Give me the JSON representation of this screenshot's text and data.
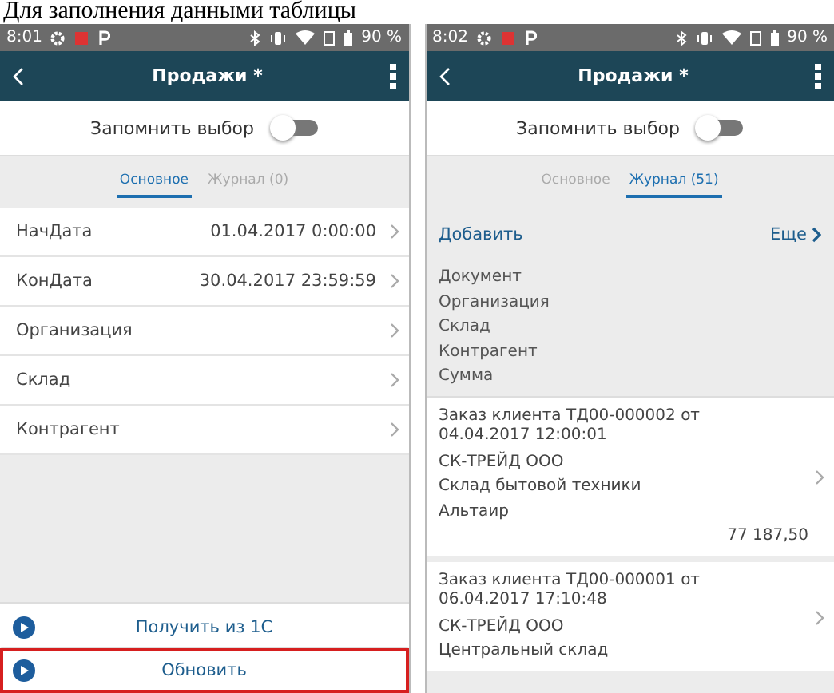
{
  "caption": "Для заполнения данными таблицы",
  "screens": [
    {
      "kind": "form",
      "status_bar": {
        "time": "8:01",
        "battery": "90 %"
      },
      "header": {
        "title": "Продажи *"
      },
      "remember": {
        "label": "Запомнить выбор",
        "on": false
      },
      "tabs": [
        {
          "label": "Основное",
          "selected": true
        },
        {
          "label": "Журнал (0)",
          "selected": false
        }
      ],
      "fields": [
        {
          "label": "НачДата",
          "value": "01.04.2017 0:00:00"
        },
        {
          "label": "КонДата",
          "value": "30.04.2017 23:59:59"
        },
        {
          "label": "Организация"
        },
        {
          "label": "Склад"
        },
        {
          "label": "Контрагент"
        }
      ],
      "buttons": [
        {
          "label": "Получить из 1С",
          "highlighted": false
        },
        {
          "label": "Обновить",
          "highlighted": true
        }
      ]
    },
    {
      "kind": "journal",
      "status_bar": {
        "time": "8:02",
        "battery": "90 %"
      },
      "header": {
        "title": "Продажи *"
      },
      "remember": {
        "label": "Запомнить выбор",
        "on": false
      },
      "tabs": [
        {
          "label": "Основное",
          "selected": false
        },
        {
          "label": "Журнал (51)",
          "selected": true
        }
      ],
      "actions": {
        "add": "Добавить",
        "more": "Еще"
      },
      "columns": [
        "Документ",
        "Организация",
        "Склад",
        "Контрагент",
        "Сумма"
      ],
      "entries": [
        {
          "title": "Заказ клиента ТД00-000002 от 04.04.2017 12:00:01",
          "lines": [
            "СК-ТРЕЙД ООО",
            "Склад бытовой техники",
            "Альтаир"
          ],
          "sum": "77 187,50"
        },
        {
          "title": "Заказ клиента ТД00-000001 от 06.04.2017 17:10:48",
          "lines": [
            "СК-ТРЕЙД ООО",
            "Центральный склад"
          ]
        }
      ]
    }
  ]
}
